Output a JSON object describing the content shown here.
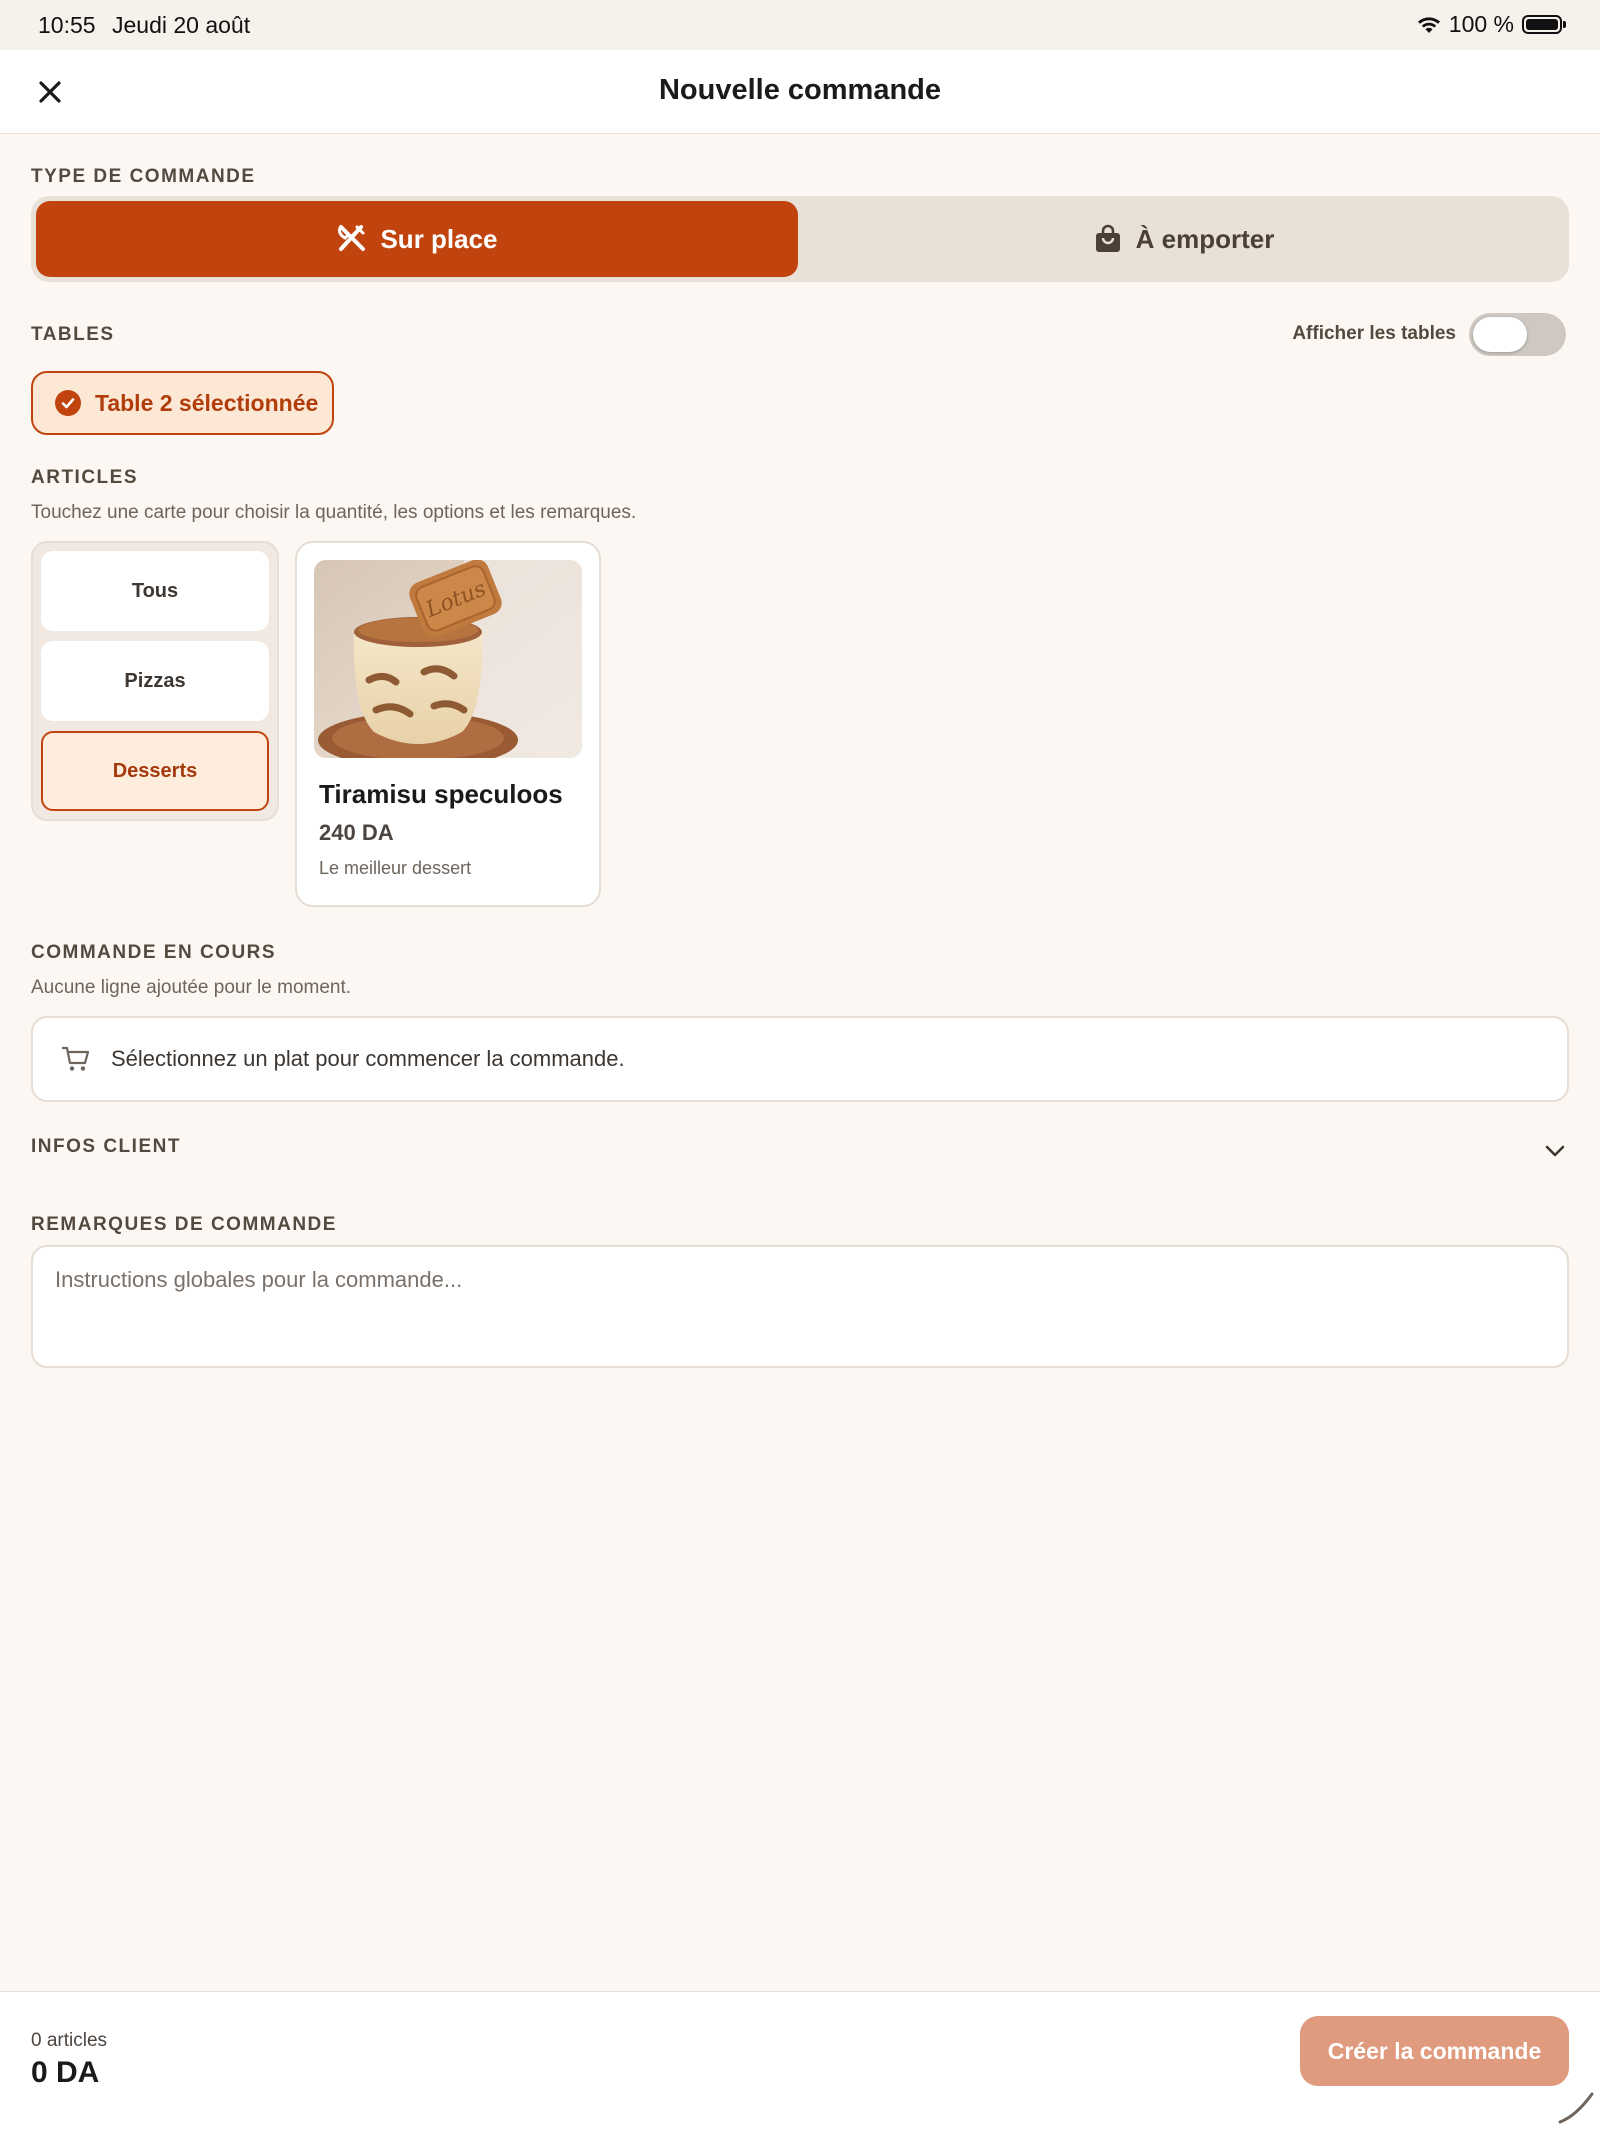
{
  "status_bar": {
    "time": "10:55",
    "date": "Jeudi 20 août",
    "battery": "100 %",
    "icons": [
      "wifi-icon",
      "battery-icon"
    ]
  },
  "header": {
    "title": "Nouvelle commande",
    "close_icon": "close-icon"
  },
  "order_type": {
    "label": "TYPE DE COMMANDE",
    "options": [
      {
        "label": "Sur place",
        "icon": "utensils-icon",
        "selected": true
      },
      {
        "label": "À emporter",
        "icon": "bag-icon",
        "selected": false
      }
    ]
  },
  "tables": {
    "label": "TABLES",
    "toggle_label": "Afficher les tables",
    "toggle_on": false,
    "selected_chip": "Table 2 sélectionnée"
  },
  "articles": {
    "label": "ARTICLES",
    "hint": "Touchez une carte pour choisir la quantité, les options et les remarques.",
    "categories": [
      {
        "label": "Tous",
        "active": false
      },
      {
        "label": "Pizzas",
        "active": false
      },
      {
        "label": "Desserts",
        "active": true
      }
    ],
    "products": [
      {
        "name": "Tiramisu speculoos",
        "price": "240 DA",
        "description": "Le meilleur dessert",
        "image_text": "Lotus"
      }
    ]
  },
  "current_order": {
    "label": "COMMANDE EN COURS",
    "hint": "Aucune ligne ajoutée pour le moment.",
    "empty_message": "Sélectionnez un plat pour commencer la commande.",
    "icon": "cart-icon"
  },
  "client_info": {
    "label": "INFOS CLIENT",
    "expanded": false
  },
  "remarks": {
    "label": "REMARQUES DE COMMANDE",
    "placeholder": "Instructions globales pour la commande..."
  },
  "footer": {
    "count": "0 articles",
    "total": "0 DA",
    "create_button": "Créer la commande"
  },
  "colors": {
    "accent": "#c1440e",
    "accent_light": "#fde8d6",
    "background": "#fcf7f2",
    "button_disabled": "#e09a7d"
  }
}
